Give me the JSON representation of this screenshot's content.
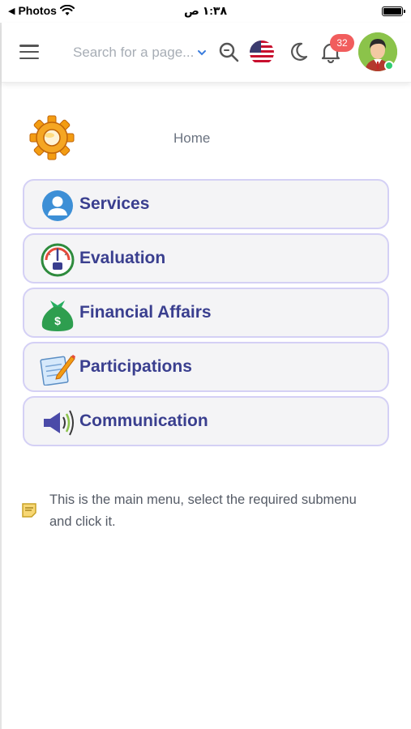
{
  "status_bar": {
    "back_app": "Photos",
    "time": "١:٣٨ ص"
  },
  "header": {
    "search_placeholder": "Search for a page...",
    "notification_count": "32"
  },
  "home": {
    "label": "Home"
  },
  "menu": {
    "items": [
      {
        "label": "Services",
        "icon": "user-circle-icon"
      },
      {
        "label": "Evaluation",
        "icon": "gauge-icon"
      },
      {
        "label": "Financial Affairs",
        "icon": "money-bag-icon"
      },
      {
        "label": "Participations",
        "icon": "notepad-pencil-icon"
      },
      {
        "label": "Communication",
        "icon": "megaphone-icon"
      }
    ]
  },
  "note": {
    "text": "This is the main menu, select the required submenu and click it."
  },
  "colors": {
    "accent_text": "#3a3f8f",
    "card_border": "#d4d0f5",
    "badge": "#f15d5d",
    "online": "#2ecc71"
  }
}
